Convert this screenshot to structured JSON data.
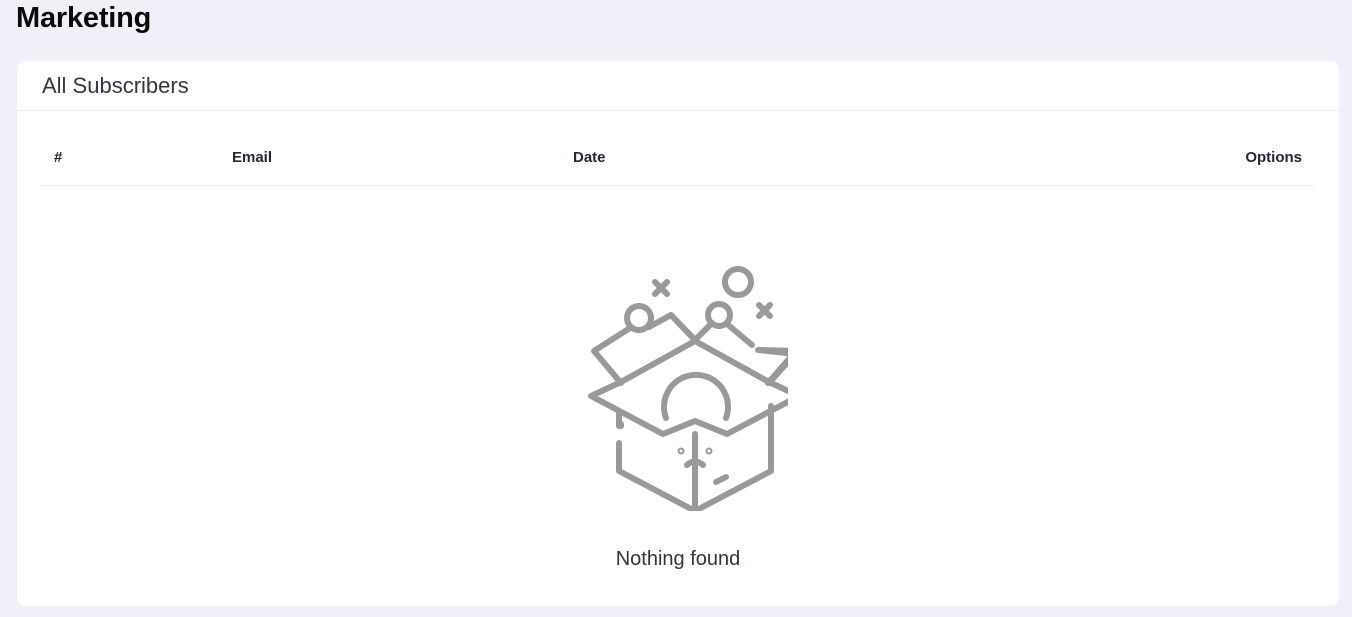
{
  "page": {
    "title": "Marketing"
  },
  "card": {
    "title": "All Subscribers",
    "table": {
      "columns": [
        "#",
        "Email",
        "Date",
        "Options"
      ],
      "rows": []
    },
    "empty_state": {
      "icon": "empty-box-sad-face-icon",
      "message": "Nothing found"
    }
  },
  "colors": {
    "page_background": "#f1eff8",
    "card_background": "#ffffff",
    "icon_gray": "#999999"
  }
}
